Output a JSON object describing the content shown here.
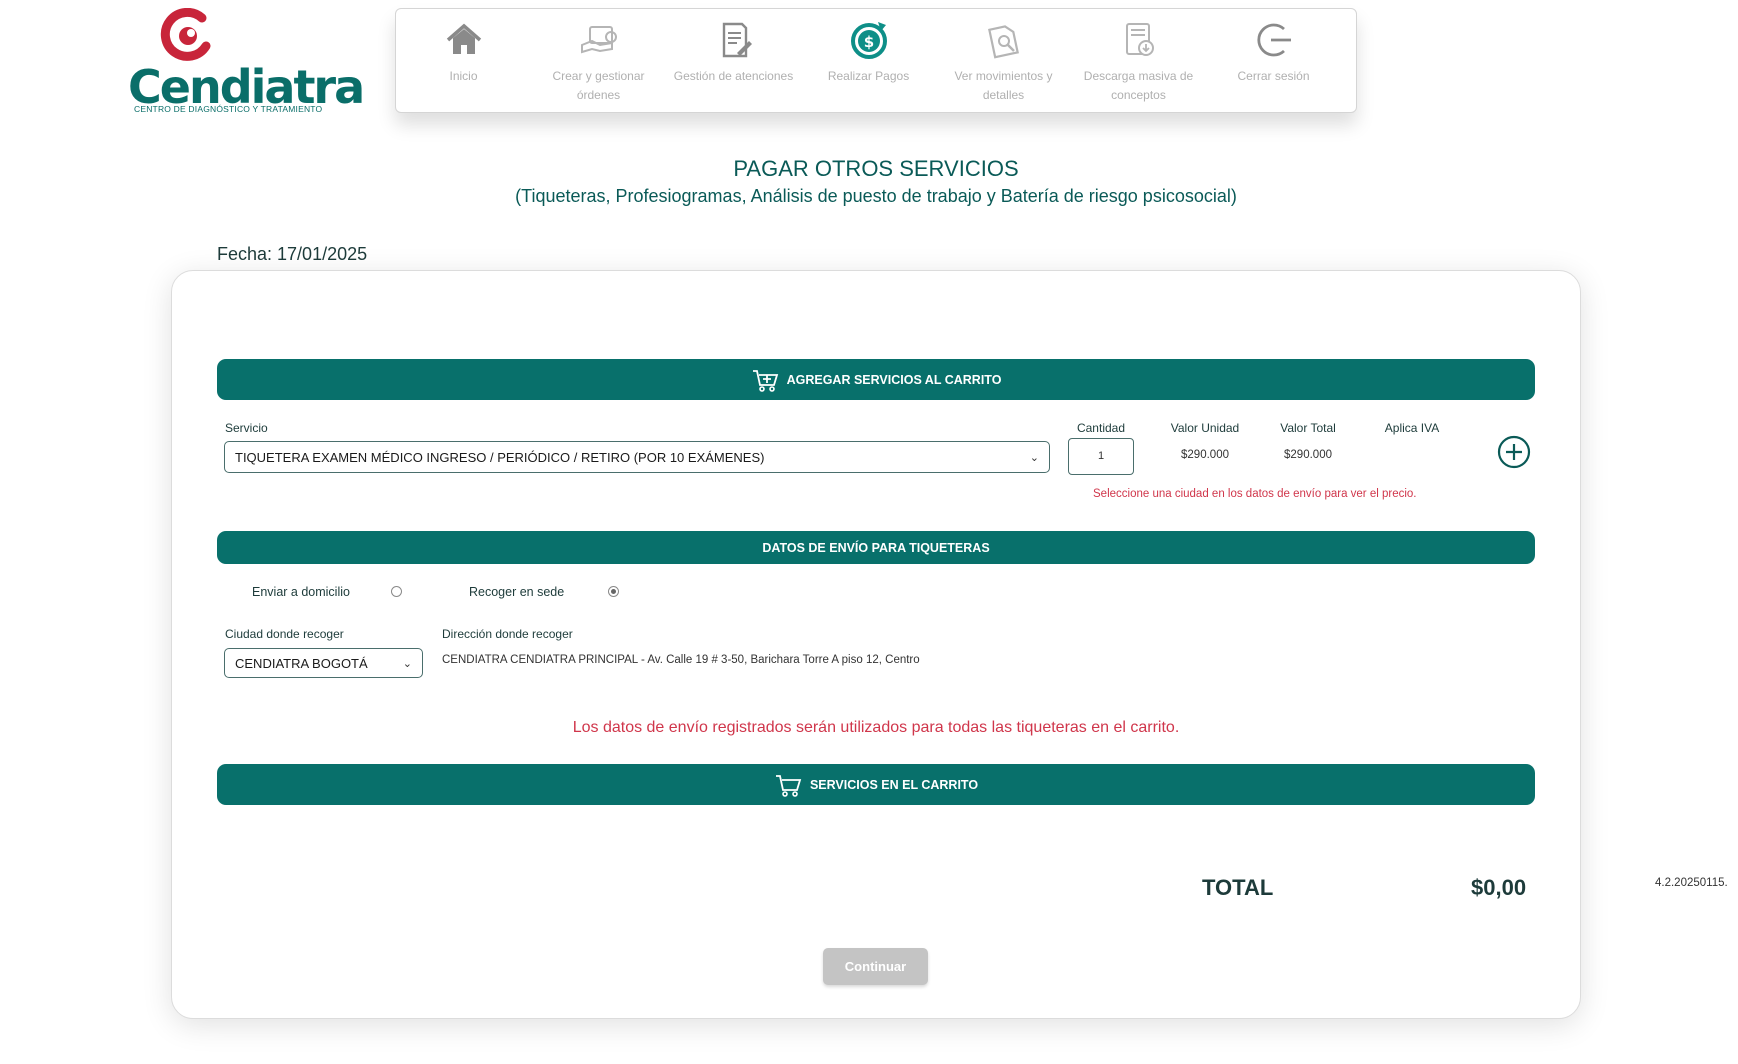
{
  "logo": {
    "name": "Cendiatra",
    "tagline": "CENTRO DE DIAGNÓSTICO Y TRATAMIENTO"
  },
  "nav": [
    {
      "label": "Inicio",
      "icon": "home-icon",
      "active": false
    },
    {
      "label": "Crear y gestionar órdenes",
      "icon": "orders-icon",
      "active": false
    },
    {
      "label": "Gestión de atenciones",
      "icon": "document-icon",
      "active": false
    },
    {
      "label": "Realizar Pagos",
      "icon": "payment-icon",
      "active": true
    },
    {
      "label": "Ver movimientos y detalles",
      "icon": "movements-icon",
      "active": false
    },
    {
      "label": "Descarga masiva de conceptos",
      "icon": "download-icon",
      "active": false
    },
    {
      "label": "Cerrar sesión",
      "icon": "logout-icon",
      "active": false
    }
  ],
  "page": {
    "title": "PAGAR OTROS SERVICIOS",
    "subtitle": "(Tiqueteras, Profesiogramas, Análisis de puesto de trabajo y Batería de riesgo psicosocial)",
    "fecha": "Fecha: 17/01/2025"
  },
  "cart_bar": {
    "label": "AGREGAR SERVICIOS AL CARRITO"
  },
  "service": {
    "label": "Servicio",
    "selected": "TIQUETERA EXAMEN MÉDICO INGRESO / PERIÓDICO / RETIRO (POR 10 EXÁMENES)",
    "qty_label": "Cantidad",
    "qty_value": "1",
    "unit_label": "Valor Unidad",
    "unit_value": "$290.000",
    "total_label": "Valor Total",
    "total_value": "$290.000",
    "iva_label": "Aplica IVA",
    "warning": "Seleccione una ciudad en los datos de envío para ver el precio."
  },
  "shipping_bar": {
    "label": "DATOS DE ENVÍO PARA TIQUETERAS"
  },
  "shipping": {
    "option_home": "Enviar a domicilio",
    "option_pickup": "Recoger en sede",
    "selected_option": "pickup",
    "city_label": "Ciudad donde recoger",
    "city_value": "CENDIATRA BOGOTÁ",
    "address_label": "Dirección donde recoger",
    "address_value": "CENDIATRA CENDIATRA PRINCIPAL - Av. Calle 19 # 3-50, Barichara Torre A piso 12, Centro",
    "notice": "Los datos de envío registrados serán utilizados para todas las tiqueteras en el carrito."
  },
  "in_cart_bar": {
    "label": "SERVICIOS EN EL CARRITO"
  },
  "summary": {
    "total_label": "TOTAL",
    "total_value": "$0,00",
    "version": "4.2.20250115."
  },
  "continue_label": "Continuar",
  "colors": {
    "primary": "#08706b",
    "warning": "#d0364b",
    "muted": "#b0b0b0",
    "logo_red": "#c8253a"
  }
}
